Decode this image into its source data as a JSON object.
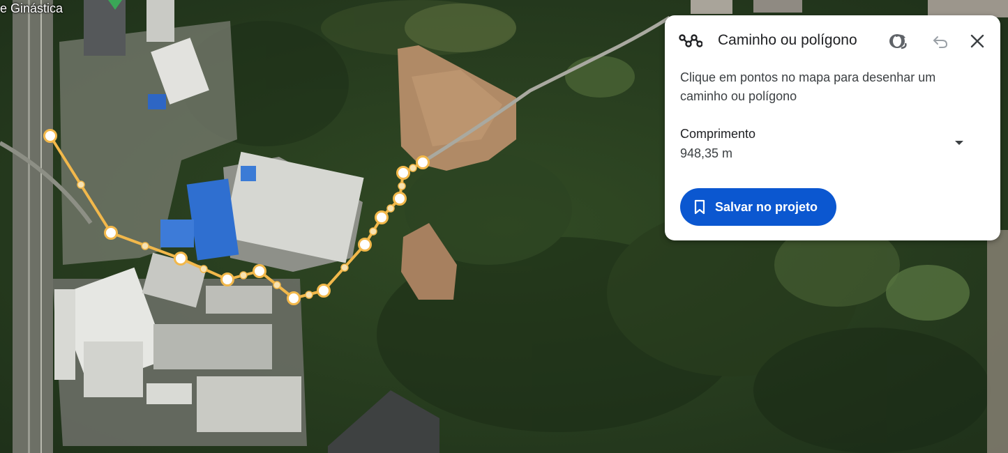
{
  "map": {
    "place_label": "e Ginástica",
    "path_color": "#f2b84b",
    "vertex_fill": "#ffffff"
  },
  "panel": {
    "title": "Caminho ou polígono",
    "path_icon": "path-icon",
    "buttons": {
      "view_3d": "3d-rotate-icon",
      "undo": "undo-icon",
      "close": "close-icon"
    },
    "instructions": "Clique em pontos no mapa para desenhar um caminho ou polígono",
    "metric": {
      "label": "Comprimento",
      "value": "948,35 m",
      "dropdown_icon": "dropdown-arrow-icon"
    },
    "save_button": {
      "label": "Salvar no projeto",
      "icon": "bookmark-icon",
      "color": "#0b57d0"
    }
  }
}
